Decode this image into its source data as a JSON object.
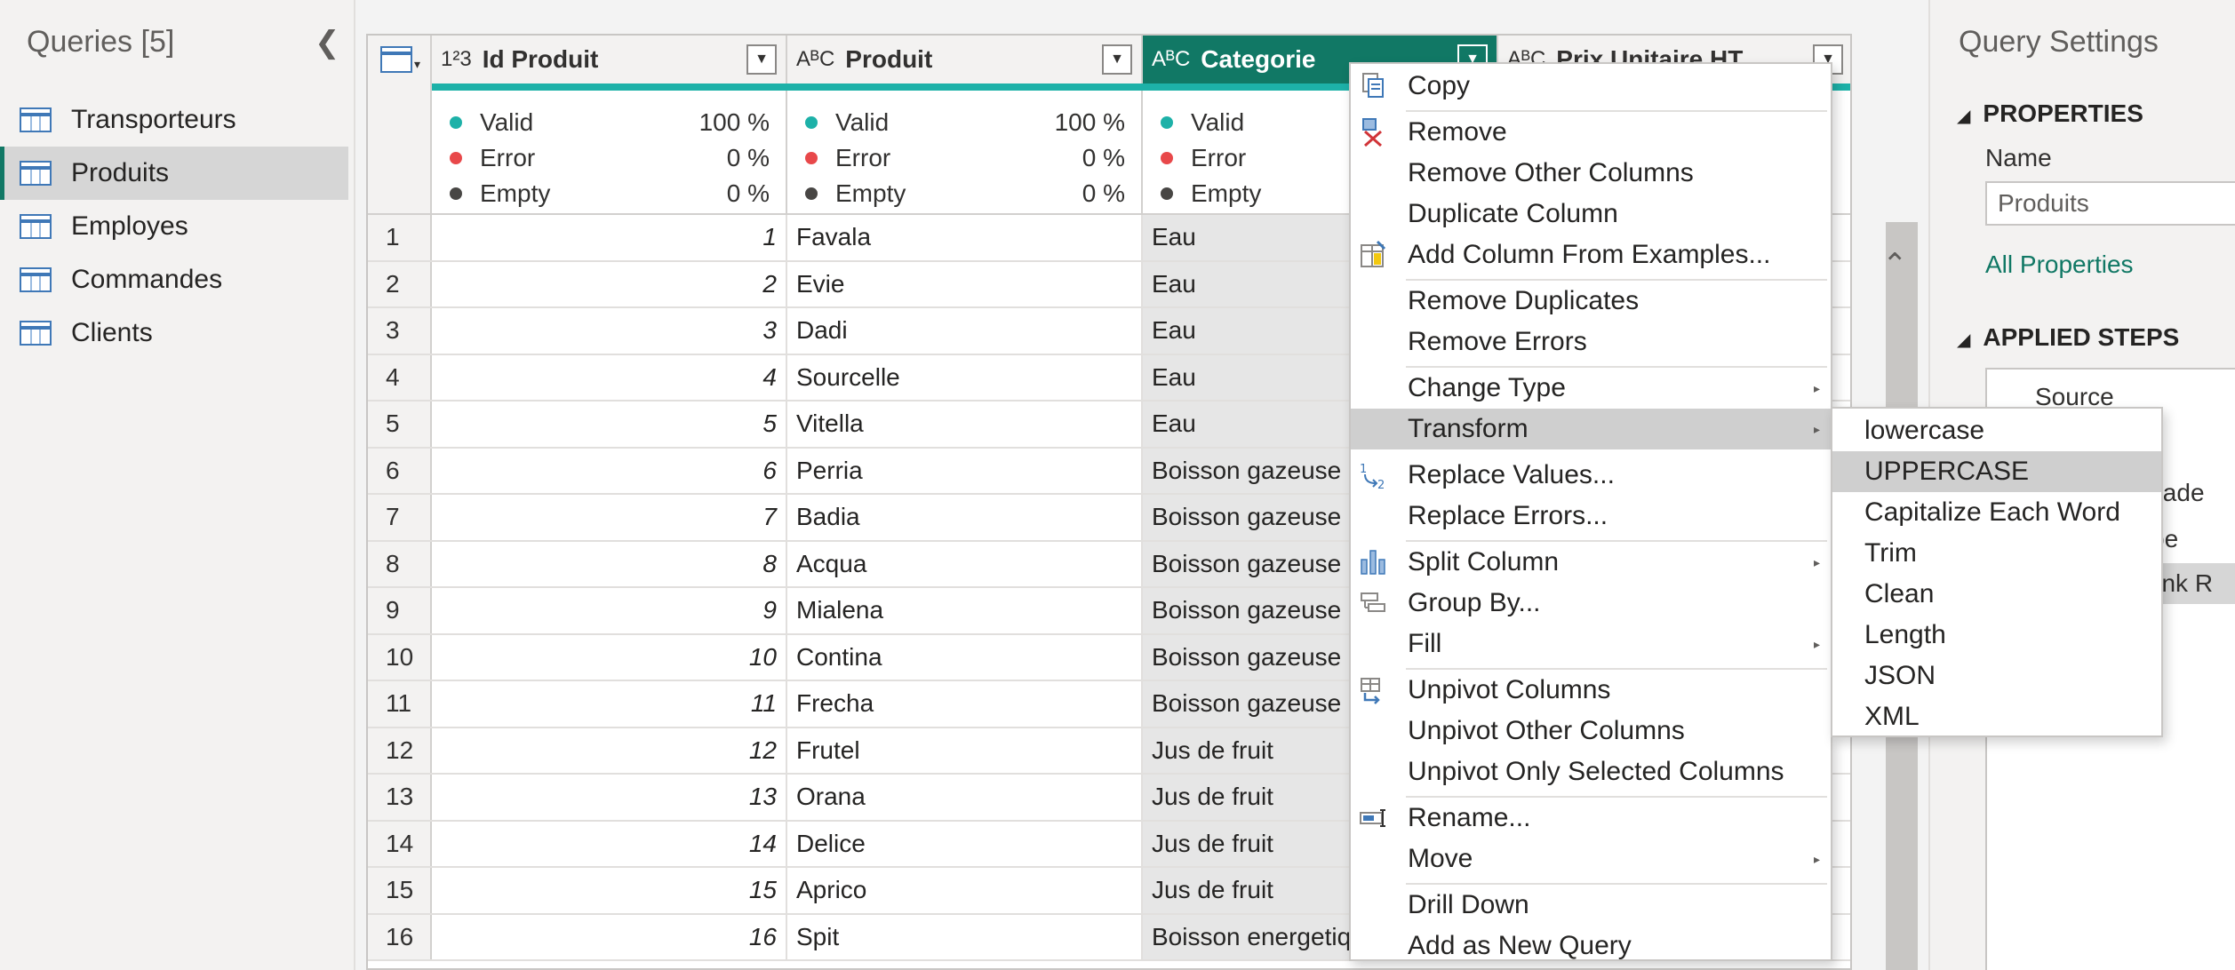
{
  "queries_pane": {
    "title": "Queries [5]",
    "collapse_icon": "chevron-left-icon",
    "items": [
      {
        "label": "Transporteurs",
        "icon": "table-icon"
      },
      {
        "label": "Produits",
        "icon": "table-icon",
        "selected": true
      },
      {
        "label": "Employes",
        "icon": "table-icon"
      },
      {
        "label": "Commandes",
        "icon": "table-icon"
      },
      {
        "label": "Clients",
        "icon": "table-icon"
      }
    ]
  },
  "grid": {
    "columns": [
      {
        "type_glyph": "1²3",
        "name": "Id Produit",
        "active": false
      },
      {
        "type_glyph": "AᴮC",
        "name": "Produit",
        "active": false
      },
      {
        "type_glyph": "AᴮC",
        "name": "Categorie",
        "active": true
      },
      {
        "type_glyph": "AᴮC",
        "name": "Prix Unitaire HT",
        "active": false
      }
    ],
    "quality": {
      "labels": {
        "valid": "Valid",
        "error": "Error",
        "empty": "Empty"
      },
      "id_produit": {
        "valid": "100 %",
        "error": "0 %",
        "empty": "0 %"
      },
      "produit": {
        "valid": "100 %",
        "error": "0 %",
        "empty": "0 %"
      }
    },
    "rows": [
      {
        "n": "1",
        "id": "1",
        "produit": "Favala",
        "categorie": "Eau"
      },
      {
        "n": "2",
        "id": "2",
        "produit": "Evie",
        "categorie": "Eau"
      },
      {
        "n": "3",
        "id": "3",
        "produit": "Dadi",
        "categorie": "Eau"
      },
      {
        "n": "4",
        "id": "4",
        "produit": "Sourcelle",
        "categorie": "Eau"
      },
      {
        "n": "5",
        "id": "5",
        "produit": "Vitella",
        "categorie": "Eau"
      },
      {
        "n": "6",
        "id": "6",
        "produit": "Perria",
        "categorie": "Boisson gazeuse"
      },
      {
        "n": "7",
        "id": "7",
        "produit": "Badia",
        "categorie": "Boisson gazeuse"
      },
      {
        "n": "8",
        "id": "8",
        "produit": "Acqua",
        "categorie": "Boisson gazeuse"
      },
      {
        "n": "9",
        "id": "9",
        "produit": "Mialena",
        "categorie": "Boisson gazeuse"
      },
      {
        "n": "10",
        "id": "10",
        "produit": "Contina",
        "categorie": "Boisson gazeuse"
      },
      {
        "n": "11",
        "id": "11",
        "produit": "Frecha",
        "categorie": "Boisson gazeuse"
      },
      {
        "n": "12",
        "id": "12",
        "produit": "Frutel",
        "categorie": "Jus de fruit"
      },
      {
        "n": "13",
        "id": "13",
        "produit": "Orana",
        "categorie": "Jus de fruit"
      },
      {
        "n": "14",
        "id": "14",
        "produit": "Delice",
        "categorie": "Jus de fruit"
      },
      {
        "n": "15",
        "id": "15",
        "produit": "Aprico",
        "categorie": "Jus de fruit"
      },
      {
        "n": "16",
        "id": "16",
        "produit": "Spit",
        "categorie": "Boisson energetique"
      }
    ]
  },
  "context_menu": {
    "items": [
      {
        "label": "Copy",
        "icon": "copy-icon"
      },
      {
        "label": "Remove",
        "icon": "remove-column-icon"
      },
      {
        "label": "Remove Other Columns"
      },
      {
        "label": "Duplicate Column"
      },
      {
        "label": "Add Column From Examples...",
        "icon": "add-column-examples-icon"
      },
      {
        "label": "Remove Duplicates"
      },
      {
        "label": "Remove Errors"
      },
      {
        "label": "Change Type",
        "submenu": true
      },
      {
        "label": "Transform",
        "submenu": true,
        "highlighted": true
      },
      {
        "label": "Replace Values...",
        "icon": "replace-values-icon"
      },
      {
        "label": "Replace Errors..."
      },
      {
        "label": "Split Column",
        "submenu": true,
        "icon": "split-column-icon"
      },
      {
        "label": "Group By...",
        "icon": "group-by-icon"
      },
      {
        "label": "Fill",
        "submenu": true
      },
      {
        "label": "Unpivot Columns",
        "icon": "unpivot-icon"
      },
      {
        "label": "Unpivot Other Columns"
      },
      {
        "label": "Unpivot Only Selected Columns"
      },
      {
        "label": "Rename...",
        "icon": "rename-icon"
      },
      {
        "label": "Move",
        "submenu": true
      },
      {
        "label": "Drill Down"
      },
      {
        "label": "Add as New Query"
      }
    ]
  },
  "transform_submenu": {
    "items": [
      {
        "label": "lowercase"
      },
      {
        "label": "UPPERCASE",
        "highlighted": true
      },
      {
        "label": "Capitalize Each Word"
      },
      {
        "label": "Trim"
      },
      {
        "label": "Clean"
      },
      {
        "label": "Length"
      },
      {
        "label": "JSON"
      },
      {
        "label": "XML"
      }
    ]
  },
  "settings": {
    "title": "Query Settings",
    "properties_header": "PROPERTIES",
    "name_label": "Name",
    "name_value": "Produits",
    "all_properties": "All Properties",
    "steps_header": "APPLIED STEPS",
    "steps": [
      {
        "label": "Source"
      },
      {
        "label": "Heade"
      },
      {
        "label": "ype"
      },
      {
        "label": "Blank R",
        "selected": true
      }
    ]
  },
  "colors": {
    "accent": "#117865",
    "quality_bar": "#1db1a8",
    "valid_dot": "#1db1a8",
    "error_dot": "#e8484a",
    "empty_dot": "#484644",
    "highlight": "#cfcfcf"
  }
}
